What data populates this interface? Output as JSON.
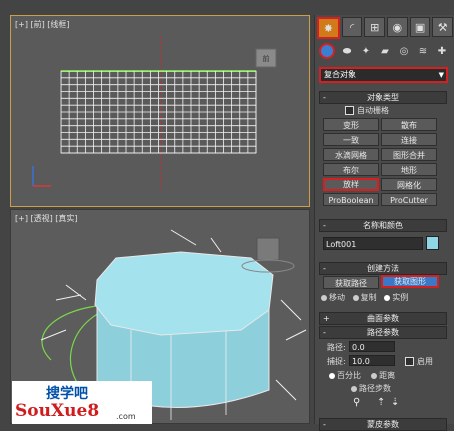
{
  "viewports": {
    "top": {
      "label": "[+] [前] [线框]",
      "cube_label": "前"
    },
    "perspective": {
      "label": "[+] [透视] [真实]"
    }
  },
  "panel": {
    "tabs": [
      "create-icon",
      "modify-icon",
      "hierarchy-icon",
      "motion-icon",
      "display-icon",
      "utilities-icon"
    ],
    "category_dropdown": "复合对象",
    "object_type": {
      "header": "对象类型",
      "autogrid": "自动栅格",
      "buttons": [
        "变形",
        "散布",
        "一致",
        "连接",
        "水滴网格",
        "图形合并",
        "布尔",
        "地形",
        "放样",
        "网格化",
        "ProBoolean",
        "ProCutter"
      ]
    },
    "name_color": {
      "header": "名称和颜色",
      "name": "Loft001",
      "color": "#8fd6e6"
    },
    "creation_method": {
      "header": "创建方法",
      "get_path": "获取路径",
      "get_shape": "获取图形",
      "options": [
        "移动",
        "复制",
        "实例"
      ]
    },
    "surface_params": {
      "header": "曲面参数"
    },
    "path_params": {
      "header": "路径参数",
      "path_label": "路径:",
      "path_value": "0.0",
      "snap_label": "捕捉:",
      "snap_value": "10.0",
      "enable_label": "启用",
      "percent": "百分比",
      "distance": "距离",
      "path_steps": "路径步数"
    },
    "skin_params": {
      "header": "蒙皮参数"
    }
  },
  "watermark": {
    "line1": "搜学吧",
    "line2": "SouXue8",
    "suffix": ".com"
  },
  "colors": {
    "accent_red": "#d62020",
    "active_blue": "#3a78c8",
    "viewport_gold": "#c8a24a"
  }
}
